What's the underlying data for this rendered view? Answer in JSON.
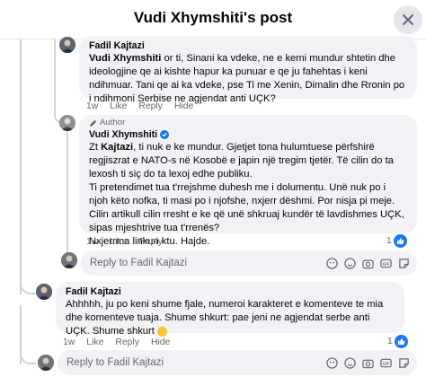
{
  "header": {
    "title": "Vudi Xhymshiti's post"
  },
  "comments": [
    {
      "author": "Fadil Kajtazi",
      "text_bold": "Vudi Xhymshiti",
      "text": " or ti, Sinani ka vdeke, ne e kemi mundur shtetin dhe ideologjine qe ai kishte hapur ka punuar e qe ju fahehtas i keni ndihmuar. Tani qe ai ka vdeke, pse Ti me Xenin, Dimalin dhe Rronin po i ndihmoni Serbise ne agjendat anti UÇK?",
      "time": "1w",
      "like": "Like",
      "reply": "Reply",
      "hide": "Hide"
    },
    {
      "author_tag": "Author",
      "author": "Vudi Xhymshiti",
      "p1_a": "Zt ",
      "p1_bold": "Kajtazi",
      "p1_b": ", ti nuk e ke mundur. Gjetjet tona hulumtuese përfshirë regjiszrat e NATO-s në Kosobë e japin një tregim tjetër. Të cilin do ta lexosh ti siç do ta lexoj edhe publiku.",
      "p2": "Ti pretendimet tua t'rrejshme duhesh me i dolumentu. Unë nuk po i njoh këto nofka, ti masi po i njofshe, nxjerr dëshmi. Por nisja pi meje. Cilin artikull cilin rresht e ke që unë shkruaj kundër të lavdishmes UÇK, sipas mjeshtrive tua t'rrenës?",
      "p3": "Nxjerrma linkun ktu. Hajde.",
      "time": "1w",
      "like": "Like",
      "reply": "Reply",
      "reactions": "1"
    },
    {
      "author": "Fadil Kajtazi",
      "text": "Ahhhhh, ju po keni shume fjale, numeroi karakteret e komenteve te mia dhe komenteve tuaja. Shume shkurt: pae jeni ne agjendat serbe anti UÇK. Shume shkurt",
      "time": "1w",
      "like": "Like",
      "reply": "Reply",
      "hide": "Hide",
      "reactions": "1"
    }
  ],
  "reply_inner": {
    "placeholder": "Reply to Fadil Kajtazi"
  },
  "reply_outer": {
    "placeholder": "Reply to Fadil Kajtazi"
  },
  "colors": {
    "accent": "#1877f2",
    "bubble": "#f0f2f5",
    "muted": "#65676b"
  },
  "icons": [
    "close-icon",
    "author-pen-icon",
    "verified-badge-icon",
    "like-icon",
    "avatar-icon",
    "camera-icon",
    "emoji-icon",
    "gif-icon",
    "sticker-icon"
  ]
}
